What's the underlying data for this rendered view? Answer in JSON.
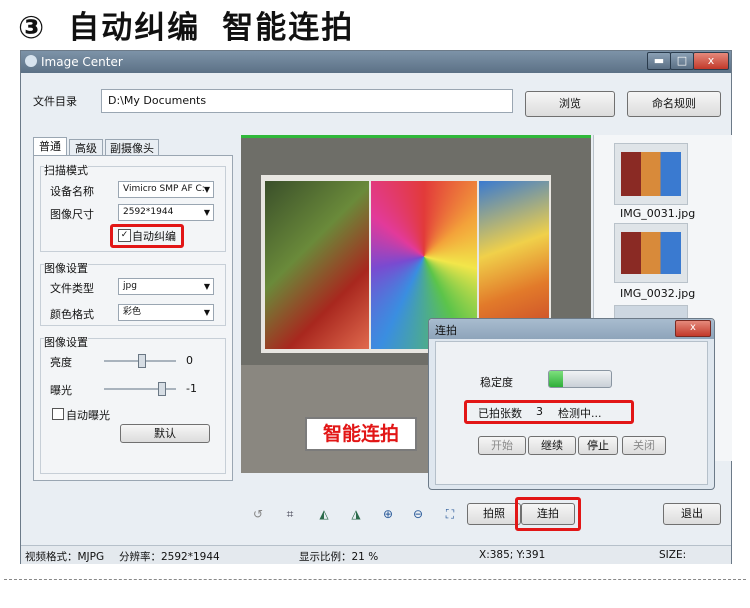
{
  "headline": {
    "number": "③",
    "feature1": "自动纠编",
    "feature2": "智能连拍"
  },
  "window": {
    "title": "Image Center",
    "buttons": {
      "minimize": "▬",
      "maximize": "□",
      "close": "x"
    }
  },
  "top": {
    "dir_label": "文件目录",
    "dir_value": "D:\\My Documents",
    "browse_label": "浏览",
    "rename_label": "命名规则"
  },
  "tabs": [
    "普通",
    "高级",
    "副摄像头"
  ],
  "scan": {
    "group_label": "扫描模式",
    "device_label": "设备名称",
    "device_value": "Vimicro SMP AF C:",
    "size_label": "图像尺寸",
    "size_value": "2592*1944",
    "autocorrect_label": "自动纠编",
    "autocorrect_checked": true
  },
  "image_settings": {
    "group_label": "图像设置",
    "filetype_label": "文件类型",
    "filetype_value": "jpg",
    "color_label": "颜色格式",
    "color_value": "彩色"
  },
  "image_settings2": {
    "group_label": "图像设置",
    "brightness_label": "亮度",
    "brightness_value": "0",
    "exposure_label": "曝光",
    "exposure_value": "-1",
    "autoexposure_label": "自动曝光",
    "default_label": "默认"
  },
  "thumbnails": [
    {
      "name": "IMG_0031.jpg"
    },
    {
      "name": "IMG_0032.jpg"
    }
  ],
  "preview_badge": "智能连拍",
  "dialog": {
    "title": "连拍",
    "close": "x",
    "stability_label": "稳定度",
    "stability_level": 0.22,
    "count_label": "已拍张数",
    "count_value": "3",
    "status": "检测中...",
    "buttons": [
      "开始",
      "继续",
      "停止",
      "关闭"
    ]
  },
  "toolbar": {
    "photo_label": "拍照",
    "burst_label": "连拍",
    "exit_label": "退出",
    "icons": [
      "rotate-icon",
      "crop-icon",
      "rotate-left-icon",
      "rotate-right-icon",
      "zoom-in-icon",
      "zoom-out-icon",
      "fit-icon"
    ]
  },
  "statusbar": {
    "format": "视频格式：MJPG",
    "resolution": "分辨率：2592*1944",
    "zoom": "显示比例：21 %",
    "coords": "X:385; Y:391",
    "size": "SIZE:"
  },
  "colors": {
    "highlight": "#e21616",
    "progress": "#3cc24a"
  }
}
